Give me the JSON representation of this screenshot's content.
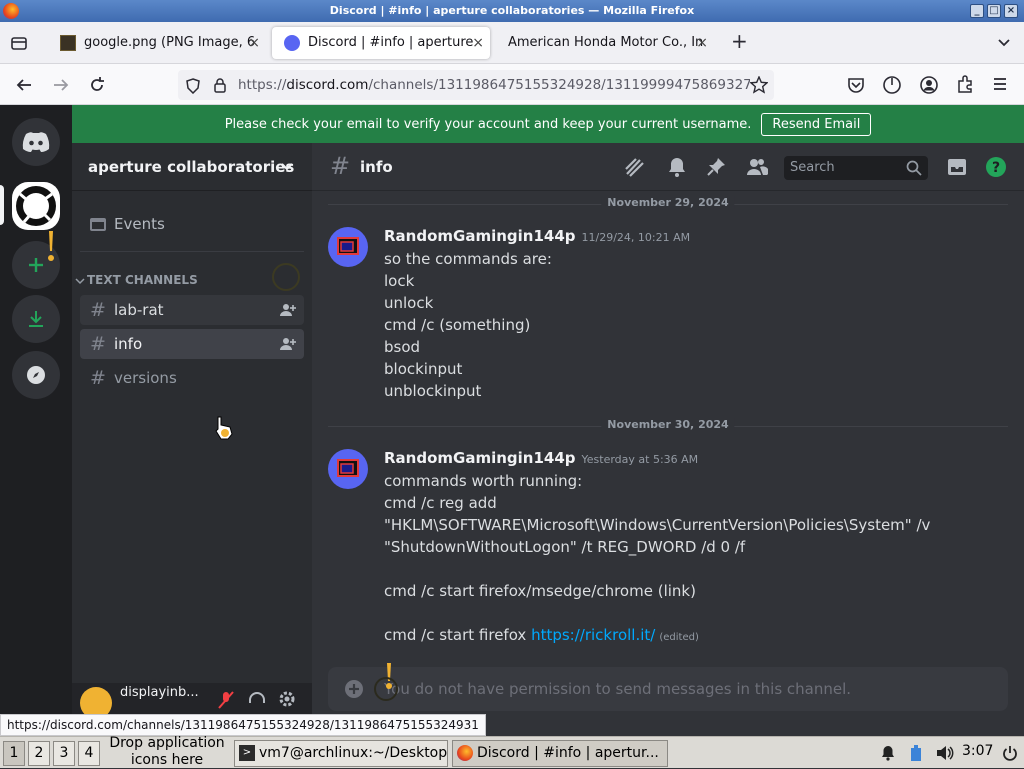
{
  "window": {
    "title": "Discord | #info | aperture collaboratories — Mozilla Firefox",
    "min": "_",
    "max": "□",
    "close": "×"
  },
  "browser": {
    "tabs": [
      {
        "label": "google.png (PNG Image, 6",
        "icon": "image-icon",
        "active": false
      },
      {
        "label": "Discord | #info | aperture",
        "icon": "discord-icon",
        "active": true
      },
      {
        "label": "American Honda Motor Co., In",
        "icon": "none",
        "active": false
      }
    ],
    "tab_close": "×",
    "new_tab": "+",
    "url_scheme": "https://",
    "url_host": "discord.com",
    "url_path": "/channels/1311986475155324928/13119999475869327"
  },
  "discord": {
    "banner_text": "Please check your email to verify your account and keep your current username.",
    "banner_button": "Resend Email",
    "guild_name": "aperture collaboratories",
    "events_label": "Events",
    "category_label": "TEXT CHANNELS",
    "channels": [
      {
        "name": "lab-rat",
        "state": "hover"
      },
      {
        "name": "info",
        "state": "selected"
      },
      {
        "name": "versions",
        "state": "normal"
      }
    ],
    "user_name": "displayinb...",
    "channel_title": "info",
    "search_placeholder": "Search",
    "messages": [
      {
        "date_divider": "November 29, 2024",
        "author": "RandomGamingin144p",
        "timestamp": "11/29/24, 10:21 AM",
        "lines": [
          "so the commands are:",
          "lock",
          "unlock",
          "cmd /c (something)",
          "bsod",
          "blockinput",
          "unblockinput"
        ]
      },
      {
        "date_divider": "November 30, 2024",
        "author": "RandomGamingin144p",
        "timestamp": "Yesterday at 5:36 AM",
        "lines": [
          "commands worth running:",
          "cmd /c reg add",
          "\"HKLM\\SOFTWARE\\Microsoft\\Windows\\CurrentVersion\\Policies\\System\" /v",
          "\"ShutdownWithoutLogon\" /t REG_DWORD /d 0 /f",
          "",
          "cmd /c start firefox/msedge/chrome (link)",
          ""
        ],
        "last_line_text": "cmd /c start firefox ",
        "last_line_link": "https://rickroll.it/",
        "edited": "(edited)"
      }
    ],
    "composer_placeholder": "You do not have permission to send messages in this channel."
  },
  "status_url": "https://discord.com/channels/1311986475155324928/1311986475155324931",
  "taskbar": {
    "workspaces": [
      "1",
      "2",
      "3",
      "4"
    ],
    "drop_hint": "Drop application icons here",
    "tasks": [
      {
        "label": "vm7@archlinux:~/Desktop",
        "icon": "terminal-icon"
      },
      {
        "label": "Discord | #info | apertur...",
        "icon": "firefox-icon"
      }
    ],
    "clock": "3:07"
  },
  "colors": {
    "banner": "#248046",
    "blurple": "#5865f2",
    "link": "#00a8fc",
    "help_green": "#23a55a"
  }
}
